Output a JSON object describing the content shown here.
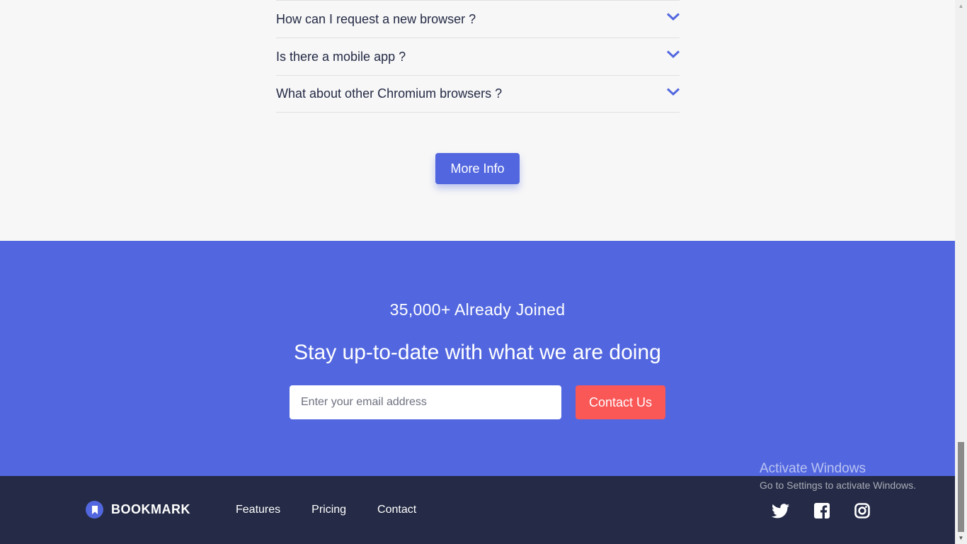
{
  "faq": {
    "questions": [
      "How can I request a new browser ?",
      "Is there a mobile app ?",
      "What about other Chromium browsers ?"
    ],
    "more_info_label": "More Info"
  },
  "cta": {
    "count_text": "35,000+ Already Joined",
    "title": "Stay up-to-date with what we are doing",
    "email_placeholder": "Enter your email address",
    "contact_label": "Contact Us"
  },
  "footer": {
    "brand": "BOOKMARK",
    "nav": [
      "Features",
      "Pricing",
      "Contact"
    ],
    "social_icons": [
      "twitter-icon",
      "facebook-icon",
      "instagram-icon"
    ]
  },
  "watermark": {
    "line1": "Activate Windows",
    "line2": "Go to Settings to activate Windows."
  },
  "colors": {
    "primary": "#5267df",
    "accent_red": "#fa5757",
    "dark": "#252b46",
    "background": "#f7f7f7"
  }
}
